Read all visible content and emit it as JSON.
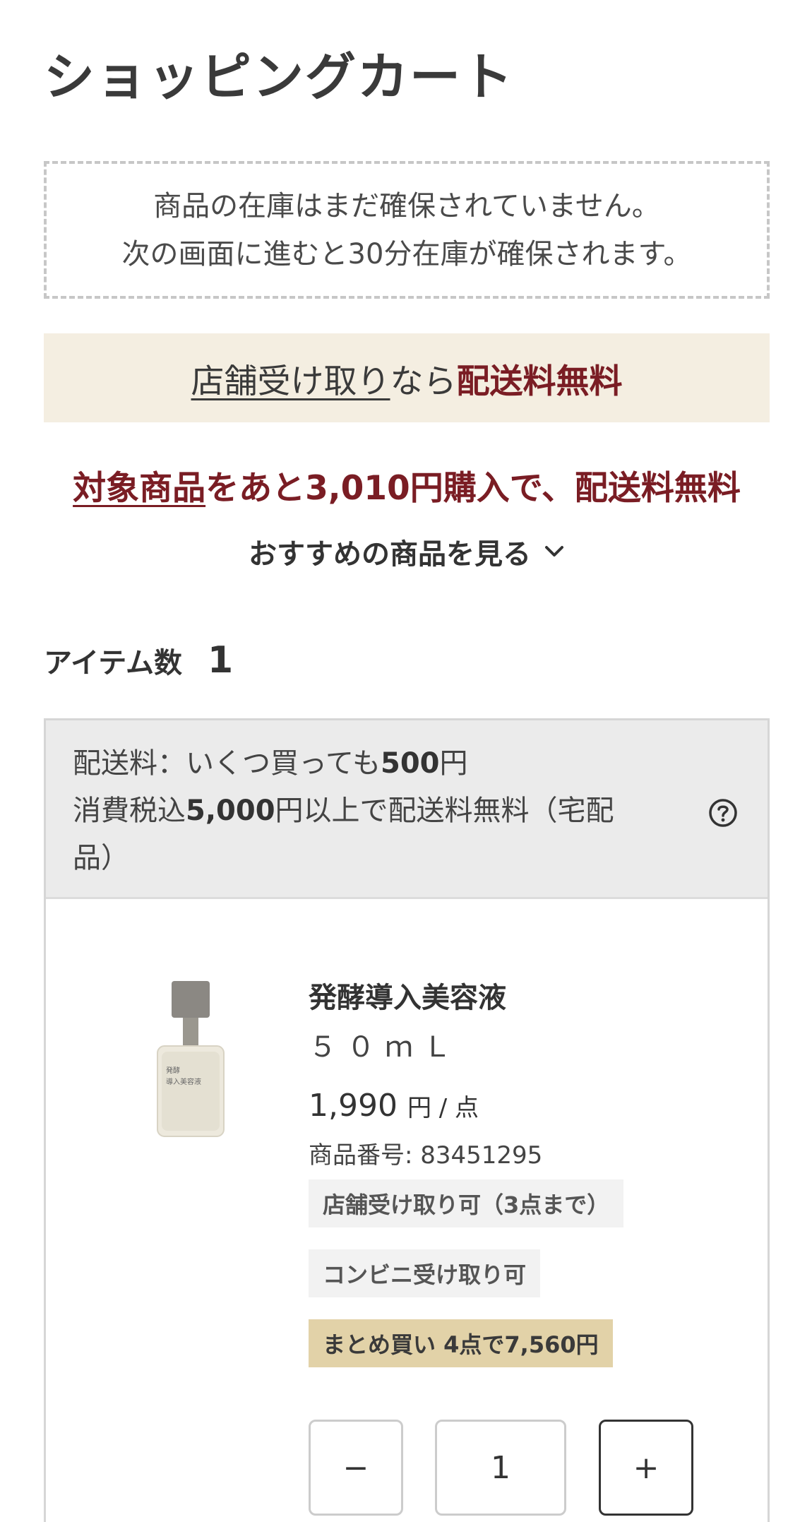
{
  "header": {
    "title": "ショッピングカート"
  },
  "stock_notice": {
    "line1": "商品の在庫はまだ確保されていません。",
    "line2": "次の画面に進むと30分在庫が確保されます。"
  },
  "pickup_banner": {
    "link_text": "店舗受け取り",
    "middle_text": "なら",
    "accent_text": "配送料無料"
  },
  "free_shipping": {
    "target_text": "対象商品",
    "rest_text": "をあと3,010円購入で、配送料無料",
    "recommend_label": "おすすめの商品を見る"
  },
  "item_count": {
    "label": "アイテム数",
    "value": "1"
  },
  "shipping_info": {
    "line1_prefix": "配送料：いくつ買っても",
    "line1_amount": "500",
    "line1_suffix": "円",
    "line2_prefix": "消費税込",
    "line2_amount": "5,000",
    "line2_suffix": "円以上で配送料無料（宅配",
    "line3": "品）"
  },
  "product": {
    "image_label_line1": "発酵",
    "image_label_line2": "導入美容液",
    "name": "発酵導入美容液",
    "size": "５０ｍＬ",
    "price": "1,990",
    "price_unit": "円 / 点",
    "number_label": "商品番号: 83451295",
    "tags": {
      "store_pickup": "店舗受け取り可（3点まで）",
      "convenience_pickup": "コンビニ受け取り可",
      "bulk_buy": "まとめ買い 4点で7,560円"
    }
  },
  "quantity": {
    "minus_label": "−",
    "value": "1",
    "plus_label": "+"
  },
  "colors": {
    "accent": "#7a1d24",
    "banner_bg": "#f4eee1",
    "bulk_tag_bg": "#e2d2a8",
    "info_bg": "#ebebeb"
  },
  "icons": {
    "recommend": "chevron-down-icon",
    "shipping_help": "help-circle-icon"
  }
}
